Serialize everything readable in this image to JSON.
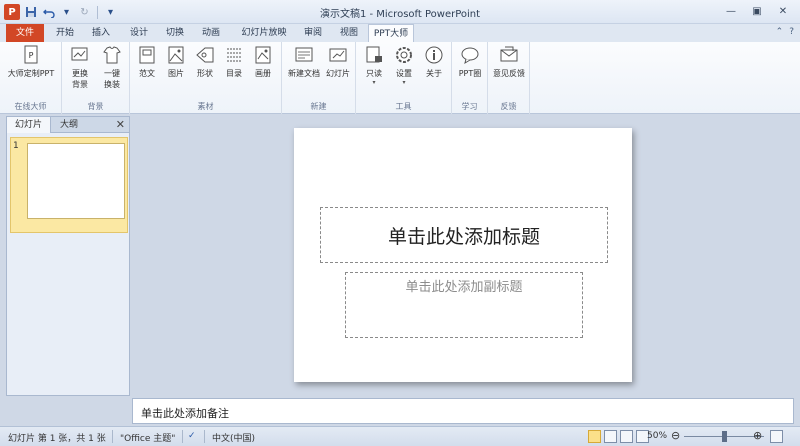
{
  "window": {
    "title": "演示文稿1 - Microsoft PowerPoint",
    "app_icon": "P",
    "controls": [
      "minimize-icon",
      "restore-icon",
      "close-icon"
    ]
  },
  "quick_access": [
    "save-icon",
    "undo-icon",
    "redo-icon",
    "customize-icon"
  ],
  "tabs": [
    {
      "label": "文件"
    },
    {
      "label": "开始"
    },
    {
      "label": "插入"
    },
    {
      "label": "设计"
    },
    {
      "label": "切换"
    },
    {
      "label": "动画"
    },
    {
      "label": "幻灯片放映"
    },
    {
      "label": "审阅"
    },
    {
      "label": "视图"
    },
    {
      "label": "PPT大师"
    }
  ],
  "active_tab": "PPT大师",
  "ribbon": {
    "groups": [
      {
        "label": "在线大师",
        "buttons": [
          {
            "label": "大师定制PPT",
            "icon": "ppt-doc-icon"
          }
        ]
      },
      {
        "label": "背景",
        "buttons": [
          {
            "label": "更换",
            "label2": "背景",
            "icon": "background-icon"
          },
          {
            "label": "一键",
            "label2": "换装",
            "icon": "shirt-icon"
          }
        ]
      },
      {
        "label": "素材",
        "buttons": [
          {
            "label": "范文",
            "icon": "template-icon"
          },
          {
            "label": "图片",
            "icon": "picture-icon"
          },
          {
            "label": "形状",
            "icon": "shape-icon"
          },
          {
            "label": "目录",
            "icon": "toc-icon"
          },
          {
            "label": "画册",
            "icon": "album-icon"
          }
        ]
      },
      {
        "label": "新建",
        "buttons": [
          {
            "label": "新建文档",
            "icon": "new-doc-icon"
          },
          {
            "label": "幻灯片",
            "icon": "slide-icon"
          }
        ]
      },
      {
        "label": "工具",
        "buttons": [
          {
            "label": "只读",
            "icon": "lock-doc-icon"
          },
          {
            "label": "设置",
            "icon": "gear-icon"
          },
          {
            "label": "关于",
            "icon": "info-icon"
          }
        ]
      },
      {
        "label": "学习",
        "buttons": [
          {
            "label": "PPT圈",
            "icon": "chat-icon"
          }
        ]
      },
      {
        "label": "反馈",
        "buttons": [
          {
            "label": "意见反馈",
            "icon": "mail-icon"
          }
        ]
      }
    ]
  },
  "left_panel": {
    "tabs": [
      "幻灯片",
      "大纲"
    ],
    "slide_number": "1"
  },
  "slide": {
    "title_placeholder": "单击此处添加标题",
    "subtitle_placeholder": "单击此处添加副标题"
  },
  "notes_placeholder": "单击此处添加备注",
  "status": {
    "slide_info": "幻灯片 第 1 张，共 1 张",
    "theme": "\"Office 主题\"",
    "language": "中文(中国)",
    "zoom": "50%",
    "zoom_value": 0.5
  },
  "colors": {
    "file_tab": "#d24726",
    "thumbnail_highlight": "#fbe8a3"
  }
}
